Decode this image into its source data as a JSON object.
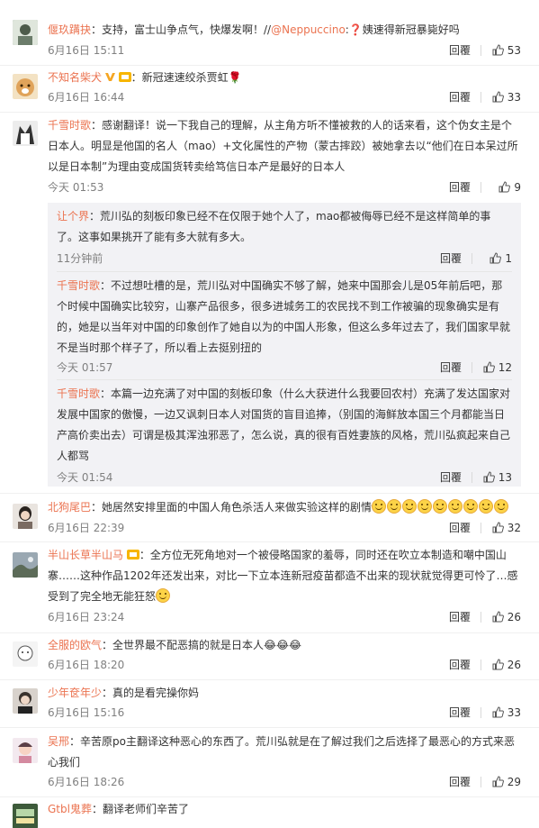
{
  "comments": [
    {
      "name": "偃玖蹒抉",
      "text": "：支持，富士山争点气，快爆发啊！//",
      "mention": "@Neppuccino",
      "tail": ":❓姨速得新冠暴毙好吗",
      "time": "6月16日 15:11",
      "reply": "回覆",
      "likes": "53"
    },
    {
      "name": "不知名柴犬",
      "text": "：新冠速速绞杀贾虹🌹",
      "time": "6月16日 16:44",
      "reply": "回覆",
      "likes": "33"
    },
    {
      "name": "千雪时歌",
      "text": "：感谢翻译！说一下我自己的理解，从主角方听不懂被救的人的话来看，这个伪女主是个日本人。明显是他国的名人（mao）+文化属性的产物（蒙古摔跤）被她拿去以“他们在日本呆过所以是日本制”为理由变成国货转卖给笃信日本产是最好的日本人",
      "time": "今天 01:53",
      "reply": "回覆",
      "likes": "9"
    },
    {
      "name": "北狗尾巴",
      "text": "：她居然安排里面的中国人角色杀活人来做实验这样的剧情",
      "time": "6月16日 22:39",
      "reply": "回覆",
      "likes": "32"
    },
    {
      "name": "半山长草半山马",
      "text": "：全方位无死角地对一个被侵略国家的羞辱，同时还在吹立本制造和嘲中国山寨……这种作品1202年还发出来，对比一下立本连新冠疫苗都造不出来的现状就觉得更可怜了…感受到了完全地无能狂怒",
      "time": "6月16日 23:24",
      "reply": "回覆",
      "likes": "26"
    },
    {
      "name": "全服的欧气",
      "text": "：全世界最不配恶搞的就是日本人😂😂😂",
      "time": "6月16日 18:20",
      "reply": "回覆",
      "likes": "26"
    },
    {
      "name": "少年奁年少",
      "text": "：真的是看完操你妈",
      "time": "6月16日 15:16",
      "reply": "回覆",
      "likes": "33"
    },
    {
      "name": "吴邢",
      "text": "：辛苦原po主翻译这种恶心的东西了。荒川弘就是在了解过我们之后选择了最恶心的方式来恶心我们",
      "time": "6月16日 18:26",
      "reply": "回覆",
      "likes": "29"
    },
    {
      "name": "Gtbl鬼葬",
      "text": "：翻译老师们辛苦了",
      "time": "",
      "reply": "",
      "likes": ""
    }
  ],
  "replies": [
    {
      "name": "让个界",
      "text": "：荒川弘的刻板印象已经不在仅限于她个人了，mao都被侮辱已经不是这样简单的事了。这事如果挑开了能有多大就有多大。",
      "time": "11分钟前",
      "reply": "回覆",
      "likes": "1"
    },
    {
      "name": "千雪时歌",
      "text": "：不过想吐槽的是，荒川弘对中国确实不够了解，她来中国那会儿是05年前后吧，那个时候中国确实比较穷，山寨产品很多，很多进城务工的农民找不到工作被骗的现象确实是有的，她是以当年对中国的印象创作了她自以为的中国人形象，但这么多年过去了，我们国家早就不是当时那个样子了，所以看上去挺别扭的",
      "time": "今天 01:57",
      "reply": "回覆",
      "likes": "12"
    },
    {
      "name": "千雪时歌",
      "text": "：本篇一边充满了对中国的刻板印象（什么大获进什么我要回农村）充满了发达国家对发展中国家的傲慢，一边又讽刺日本人对国货的盲目追捧，（别国的海鲜放本国三个月都能当日产高价卖出去）可谓是极其浑浊邪恶了，怎么说，真的很有百姓妻族的风格，荒川弘疯起来自己人都骂",
      "time": "今天 01:54",
      "reply": "回覆",
      "likes": "13"
    }
  ],
  "colors": {
    "name": "#eb7350",
    "meta": "#808080",
    "subbg": "#f2f2f5"
  }
}
